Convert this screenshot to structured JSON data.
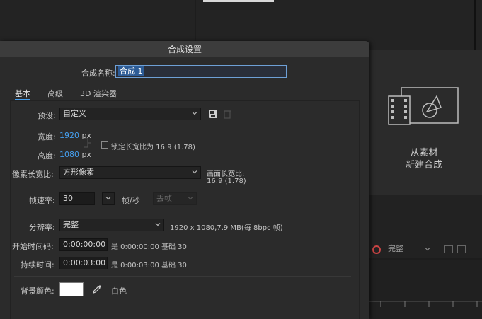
{
  "background": {
    "comp_from_footage_line1": "从素材",
    "comp_from_footage_line2": "新建合成",
    "mini_toolbar_resolution": "完整"
  },
  "dialog": {
    "title": "合成设置",
    "comp_name_label": "合成名称:",
    "comp_name_value": "合成 1",
    "tabs": [
      {
        "label": "基本",
        "active": true
      },
      {
        "label": "高级",
        "active": false
      },
      {
        "label": "3D 渲染器",
        "active": false
      }
    ],
    "preset": {
      "label": "预设:",
      "value": "自定义"
    },
    "width": {
      "label": "宽度:",
      "value": "1920",
      "unit": "px"
    },
    "height": {
      "label": "高度:",
      "value": "1080",
      "unit": "px"
    },
    "lock_aspect": {
      "label": "锁定长宽比为 16:9 (1.78)",
      "checked": false
    },
    "pixel_aspect": {
      "label": "像素长宽比:",
      "value": "方形像素"
    },
    "frame_aspect": {
      "label": "画面长宽比:",
      "value": "16:9 (1.78)"
    },
    "frame_rate": {
      "label": "帧速率:",
      "value": "30",
      "unit": "帧/秒",
      "drop_frame": "丢帧"
    },
    "resolution": {
      "label": "分辨率:",
      "value": "完整",
      "info": "1920 x 1080,7.9 MB(每 8bpc 帧)"
    },
    "start_timecode": {
      "label": "开始时间码:",
      "value": "0:00:00:00",
      "info": "是 0:00:00:00 基础 30"
    },
    "duration": {
      "label": "持续时间:",
      "value": "0:00:03:00",
      "info": "是 0:00:03:00 基础 30"
    },
    "background_color": {
      "label": "背景颜色:",
      "value": "#ffffff",
      "name": "白色"
    },
    "icons": {
      "preset_save": "save-preset-icon",
      "preset_delete": "delete-preset-icon",
      "eyedropper": "eyedropper-icon"
    },
    "colors": {
      "accent": "#46a0f0",
      "panel": "#2b2b2b",
      "titlebar": "#3c3c3c"
    }
  }
}
